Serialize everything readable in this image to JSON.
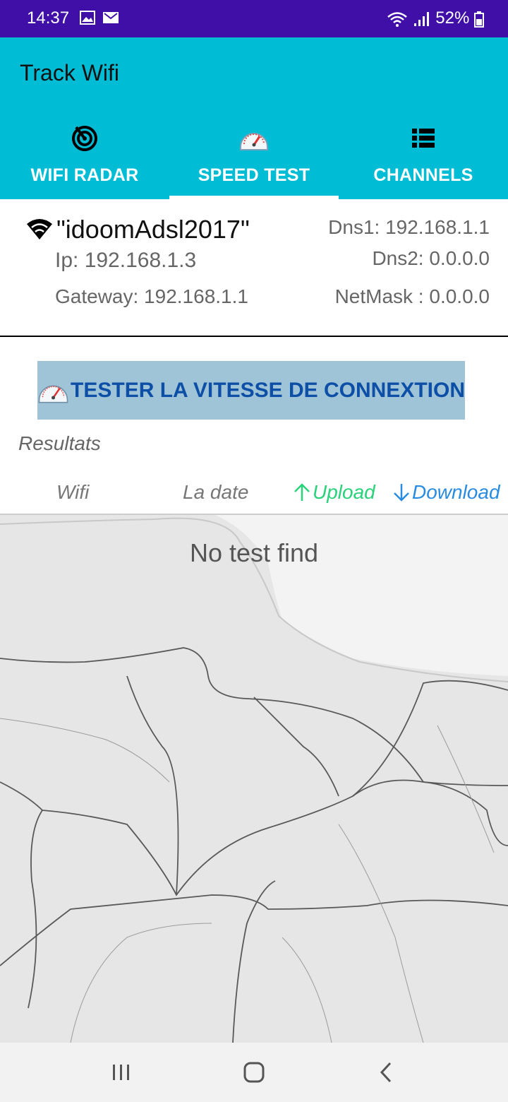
{
  "status_bar": {
    "time": "14:37",
    "battery": "52%",
    "icons": [
      "image-icon",
      "mail-icon",
      "wifi-icon",
      "signal-icon",
      "battery-icon"
    ]
  },
  "app": {
    "title": "Track Wifi"
  },
  "tabs": [
    {
      "label": "WIFI RADAR",
      "icon": "radar-icon"
    },
    {
      "label": "SPEED TEST",
      "icon": "speedometer-icon",
      "selected": true
    },
    {
      "label": "CHANNELS",
      "icon": "list-icon"
    }
  ],
  "network": {
    "ssid": "\"idoomAdsl2017\"",
    "ip": "Ip: 192.168.1.3",
    "gateway": "Gateway: 192.168.1.1",
    "dns1": "Dns1: 192.168.1.1",
    "dns2": "Dns2: 0.0.0.0",
    "netmask": "NetMask : 0.0.0.0"
  },
  "test_button": {
    "label": "TESTER LA VITESSE DE CONNEXTION"
  },
  "results": {
    "title": "Resultats",
    "columns": {
      "wifi": "Wifi",
      "date": "La date",
      "upload": "Upload",
      "download": "Download"
    },
    "empty_message": "No test find"
  },
  "colors": {
    "status_bar": "#3f0fa8",
    "app_bar": "#00bcd4",
    "button_bg": "#a0c4d7",
    "button_text": "#0d4fa6",
    "upload": "#29d27a",
    "download": "#2a8ce0"
  }
}
